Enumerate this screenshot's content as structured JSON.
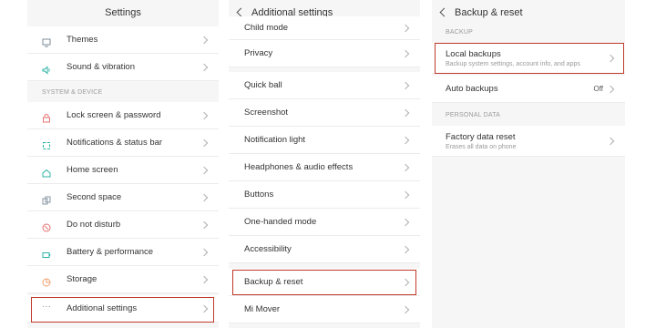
{
  "panel1": {
    "title": "Settings",
    "items_top": [
      {
        "label": "Themes",
        "icon": "themes-icon"
      },
      {
        "label": "Sound & vibration",
        "icon": "sound-icon"
      }
    ],
    "section": "SYSTEM & DEVICE",
    "items": [
      {
        "label": "Lock screen & password",
        "icon": "lock-icon"
      },
      {
        "label": "Notifications & status bar",
        "icon": "notification-icon"
      },
      {
        "label": "Home screen",
        "icon": "home-icon"
      },
      {
        "label": "Second space",
        "icon": "second-space-icon"
      },
      {
        "label": "Do not disturb",
        "icon": "do-not-disturb-icon"
      },
      {
        "label": "Battery & performance",
        "icon": "battery-icon"
      },
      {
        "label": "Storage",
        "icon": "storage-icon"
      },
      {
        "label": "Additional settings",
        "icon": "more-icon"
      }
    ]
  },
  "panel2": {
    "title": "Additional settings",
    "items": [
      {
        "label": "Child mode"
      },
      {
        "label": "Privacy"
      },
      {
        "label": "Quick ball"
      },
      {
        "label": "Screenshot"
      },
      {
        "label": "Notification light"
      },
      {
        "label": "Headphones & audio effects"
      },
      {
        "label": "Buttons"
      },
      {
        "label": "One-handed mode"
      },
      {
        "label": "Accessibility"
      },
      {
        "label": "Backup & reset"
      },
      {
        "label": "Mi Mover"
      }
    ]
  },
  "panel3": {
    "title": "Backup & reset",
    "section1": "BACKUP",
    "local_backups": {
      "label": "Local backups",
      "sub": "Backup system settings, account info, and apps"
    },
    "auto_backups": {
      "label": "Auto backups",
      "value": "Off"
    },
    "section2": "PERSONAL DATA",
    "factory_reset": {
      "label": "Factory data reset",
      "sub": "Erases all data on phone"
    }
  },
  "colors": {
    "highlight": "#c0392b",
    "icon_accent": "#e8a0a0",
    "icon_teal": "#2bb3a5"
  }
}
